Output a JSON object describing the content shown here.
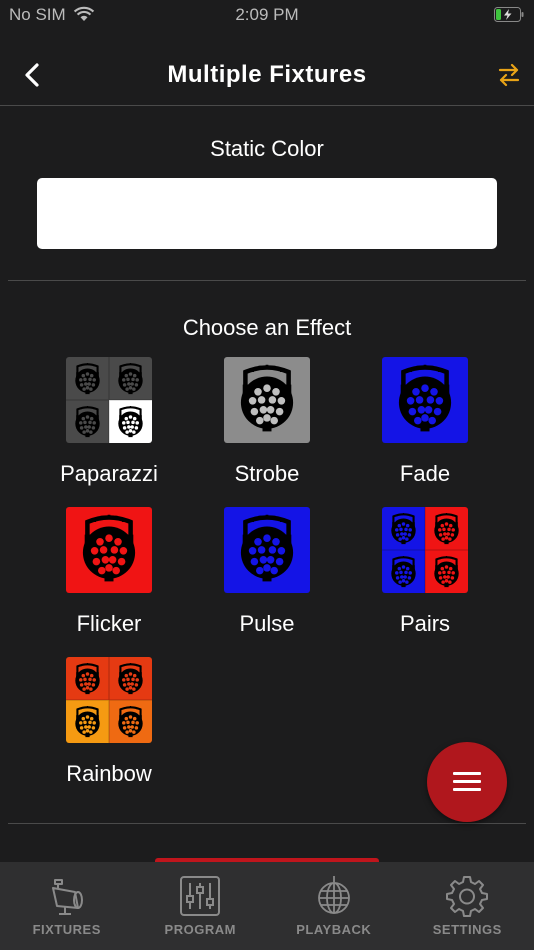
{
  "status_bar": {
    "carrier": "No SIM",
    "time": "2:09 PM"
  },
  "nav": {
    "title": "Multiple Fixtures",
    "back_icon": "chevron-left-icon",
    "swap_icon": "swap-arrows-icon",
    "accent": "#e8a317"
  },
  "static_color": {
    "title": "Static Color",
    "value": "#ffffff"
  },
  "effects": {
    "title": "Choose an Effect",
    "items": [
      {
        "label": "Paparazzi",
        "colors": [
          "#4a4a4a",
          "#4a4a4a",
          "#4a4a4a",
          "#ffffff"
        ]
      },
      {
        "label": "Strobe",
        "colors": [
          "#8c8c8c"
        ]
      },
      {
        "label": "Fade",
        "colors": [
          "#1414e6"
        ]
      },
      {
        "label": "Flicker",
        "colors": [
          "#f01414"
        ]
      },
      {
        "label": "Pulse",
        "colors": [
          "#1414e6"
        ]
      },
      {
        "label": "Pairs",
        "colors": [
          "#1414e6",
          "#f01414",
          "#1414e6",
          "#f01414"
        ]
      },
      {
        "label": "Rainbow",
        "colors": [
          "#e53a12",
          "#e53a12",
          "#f59a12",
          "#ef6a12"
        ]
      }
    ]
  },
  "fab": {
    "icon": "menu-icon",
    "color": "#b0171d"
  },
  "tabbar": {
    "items": [
      {
        "label": "FIXTURES",
        "icon": "fixture-icon"
      },
      {
        "label": "PROGRAM",
        "icon": "sliders-icon"
      },
      {
        "label": "PLAYBACK",
        "icon": "disco-ball-icon"
      },
      {
        "label": "SETTINGS",
        "icon": "gear-icon"
      }
    ]
  }
}
